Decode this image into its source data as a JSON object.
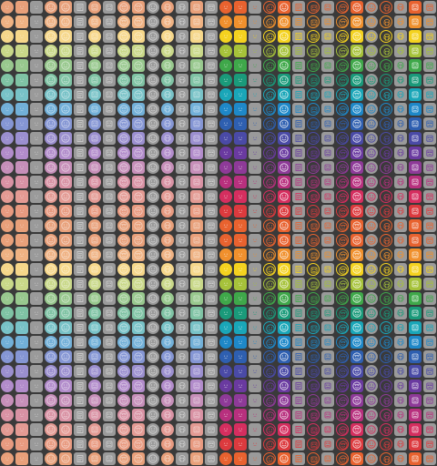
{
  "background_color": "#3a3a3a",
  "icon_sheet": {
    "columns_per_quadrant": 15,
    "rows_per_quadrant": 16,
    "column_pattern": [
      {
        "shape": "circle",
        "glyph": "blank-face-icon",
        "gray": false
      },
      {
        "shape": "square",
        "glyph": "blank-face-icon",
        "gray": false
      },
      {
        "shape": "square",
        "glyph": "blank-face-icon",
        "gray": true
      },
      {
        "shape": "circle",
        "glyph": "smiley-face-icon",
        "gray": false
      },
      {
        "shape": "square",
        "glyph": "smiley-face-icon",
        "gray": false
      },
      {
        "shape": "square",
        "glyph": "document-face-icon",
        "gray": true
      },
      {
        "shape": "circle",
        "glyph": "robot-face-icon",
        "gray": false
      },
      {
        "shape": "square",
        "glyph": "robot-face-icon",
        "gray": true
      },
      {
        "shape": "circle",
        "glyph": "heart-eyes-face-icon",
        "gray": false
      },
      {
        "shape": "square",
        "glyph": "heart-eyes-face-icon",
        "gray": false
      },
      {
        "shape": "circle",
        "glyph": "smiley-face-icon",
        "gray": true
      },
      {
        "shape": "circle",
        "glyph": "skull-icon",
        "gray": false
      },
      {
        "shape": "square",
        "glyph": "skull-icon",
        "gray": true
      },
      {
        "shape": "square",
        "glyph": "robot-face-icon",
        "gray": false
      },
      {
        "shape": "square",
        "glyph": "sunglasses-face-icon",
        "gray": true
      }
    ],
    "quadrants": [
      {
        "name": "top-left",
        "style": "pastel"
      },
      {
        "name": "top-right",
        "style": "vivid"
      },
      {
        "name": "bottom-left",
        "style": "pastel"
      },
      {
        "name": "bottom-right",
        "style": "vivid"
      }
    ],
    "pastel_row_colors": [
      "#e8a07a",
      "#efb283",
      "#f6d78a",
      "#c9d889",
      "#98c88e",
      "#7fc3a4",
      "#78c2c7",
      "#72b0d8",
      "#8596d4",
      "#9b8fcf",
      "#b28ccb",
      "#c68fb9",
      "#d992a4",
      "#e39a93",
      "#e89a80",
      "#e8a07a"
    ],
    "vivid_row_colors": [
      "#e8622f",
      "#f0902d",
      "#f4d21f",
      "#a6c23a",
      "#3fa84a",
      "#1a9a7a",
      "#1aa6b8",
      "#1e88c8",
      "#2e5fb0",
      "#4a4aa6",
      "#6a3aa0",
      "#8e3a98",
      "#b8307e",
      "#d52e5f",
      "#dc3a3e",
      "#e8622f"
    ],
    "gray_tile_color": "#9a9a9a"
  }
}
